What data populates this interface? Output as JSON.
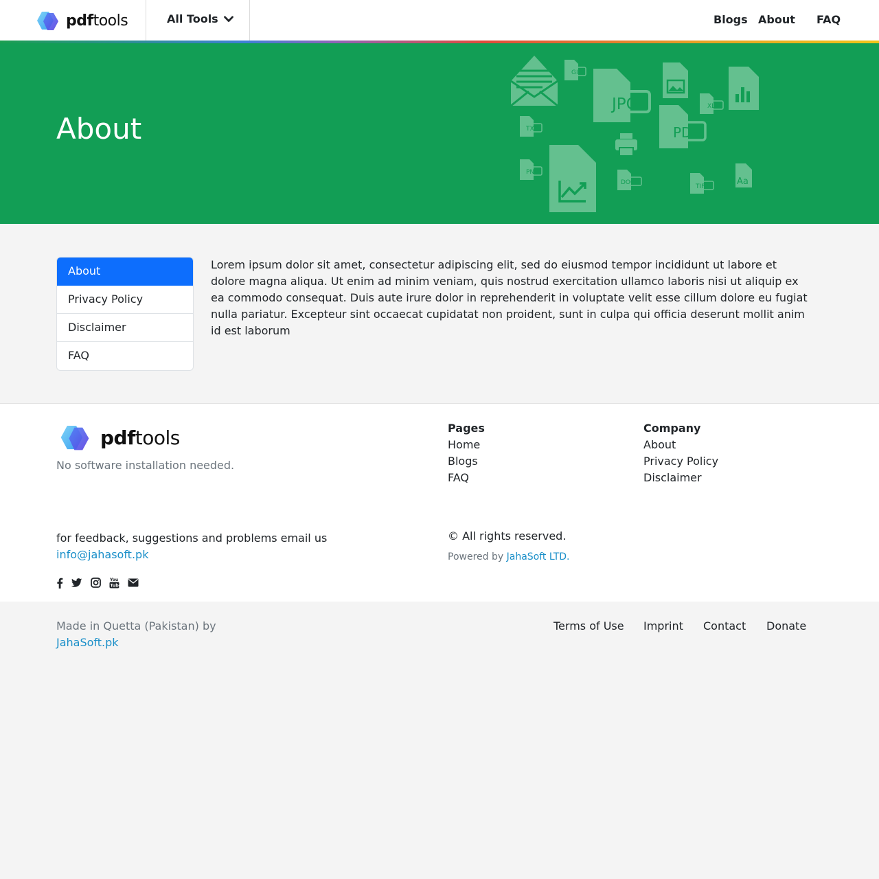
{
  "header": {
    "logo": {
      "bold": "pdf",
      "light": "tools"
    },
    "all_tools_label": "All Tools",
    "nav": [
      {
        "label": "Blogs"
      },
      {
        "label": "About"
      },
      {
        "label": "FAQ"
      }
    ]
  },
  "hero": {
    "title": "About",
    "file_icons": {
      "jpg": "JPG",
      "pdf": "PDF",
      "gif": "GIF",
      "xls": "XLS",
      "txt": "TXT",
      "png": "PNG",
      "docx": "DOCX",
      "tiff": "TIFF",
      "font": "Aa"
    }
  },
  "sidebar": {
    "items": [
      {
        "label": "About",
        "active": true
      },
      {
        "label": "Privacy Policy",
        "active": false
      },
      {
        "label": "Disclaimer",
        "active": false
      },
      {
        "label": "FAQ",
        "active": false
      }
    ]
  },
  "main": {
    "body": "Lorem ipsum dolor sit amet, consectetur adipiscing elit, sed do eiusmod tempor incididunt ut labore et dolore magna aliqua. Ut enim ad minim veniam, quis nostrud exercitation ullamco laboris nisi ut aliquip ex ea commodo consequat. Duis aute irure dolor in reprehenderit in voluptate velit esse cillum dolore eu fugiat nulla pariatur. Excepteur sint occaecat cupidatat non proident, sunt in culpa qui officia deserunt mollit anim id est laborum"
  },
  "footer": {
    "logo": {
      "bold": "pdf",
      "light": "tools"
    },
    "tagline": "No software installation needed.",
    "pages": {
      "heading": "Pages",
      "links": [
        "Home",
        "Blogs",
        "FAQ"
      ]
    },
    "company": {
      "heading": "Company",
      "links": [
        "About",
        "Privacy Policy",
        "Disclaimer"
      ]
    },
    "feedback_text": "for feedback, suggestions and problems email us",
    "email": "info@jahasoft.pk",
    "social_icons": [
      "facebook-icon",
      "twitter-icon",
      "instagram-icon",
      "youtube-icon",
      "envelope-icon"
    ],
    "rights": "© All rights reserved.",
    "powered_prefix": "Powered by",
    "powered_link": "JahaSoft LTD."
  },
  "bottom": {
    "made_in": "Made in Quetta (Pakistan) by",
    "made_link": "JahaSoft.pk",
    "links": [
      "Terms of Use",
      "Imprint",
      "Contact",
      "Donate"
    ]
  },
  "colors": {
    "hero_green": "#129e55",
    "active_blue": "#0d6efd",
    "link_blue": "#1a8fc9",
    "muted_gray": "#6c757d"
  }
}
